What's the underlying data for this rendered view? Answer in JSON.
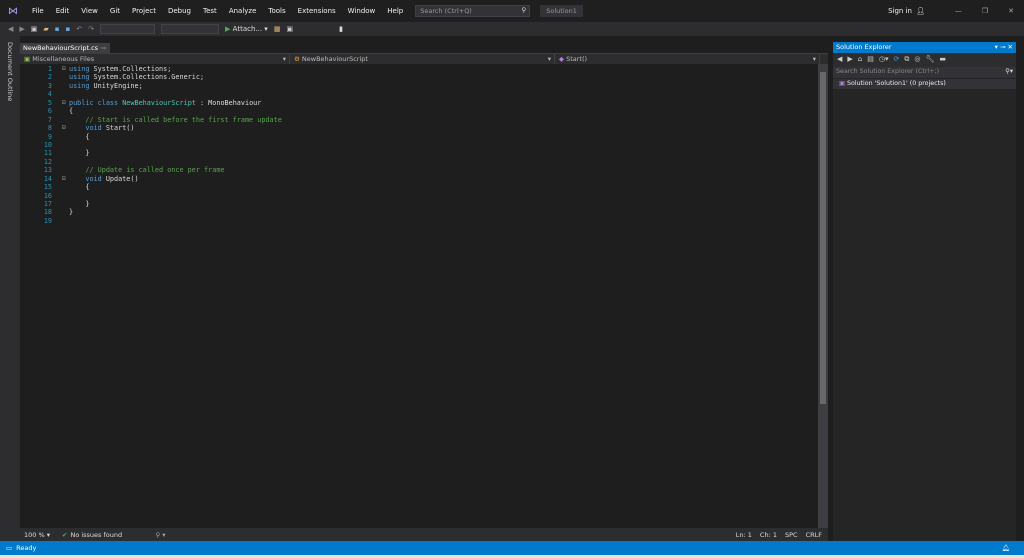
{
  "menu": [
    "File",
    "Edit",
    "View",
    "Git",
    "Project",
    "Debug",
    "Test",
    "Analyze",
    "Tools",
    "Extensions",
    "Window",
    "Help"
  ],
  "search_placeholder": "Search (Ctrl+Q)",
  "solution_name": "Solution1",
  "sign_in": "Sign in",
  "toolbar": {
    "attach": "Attach..."
  },
  "doc_outline": "Document Outline",
  "tab": {
    "label": "NewBehaviourScript.cs"
  },
  "nav": {
    "project": "Miscellaneous Files",
    "type": "NewBehaviourScript",
    "member": "Start()"
  },
  "code": [
    [
      "1",
      "using System.Collections;"
    ],
    [
      "2",
      "using System.Collections.Generic;"
    ],
    [
      "3",
      "using UnityEngine;"
    ],
    [
      "4",
      ""
    ],
    [
      "5",
      "public class NewBehaviourScript : MonoBehaviour"
    ],
    [
      "6",
      "{"
    ],
    [
      "7",
      "    // Start is called before the first frame update"
    ],
    [
      "8",
      "    void Start()"
    ],
    [
      "9",
      "    {"
    ],
    [
      "10",
      ""
    ],
    [
      "11",
      "    }"
    ],
    [
      "12",
      ""
    ],
    [
      "13",
      "    // Update is called once per frame"
    ],
    [
      "14",
      "    void Update()"
    ],
    [
      "15",
      "    {"
    ],
    [
      "16",
      ""
    ],
    [
      "17",
      "    }"
    ],
    [
      "18",
      "}"
    ],
    [
      "19",
      ""
    ]
  ],
  "editor_status": {
    "zoom": "100 %",
    "issues": "No issues found",
    "ln": "Ln: 1",
    "ch": "Ch: 1",
    "spc": "SPC",
    "crlf": "CRLF"
  },
  "solution_explorer": {
    "title": "Solution Explorer",
    "search_placeholder": "Search Solution Explorer (Ctrl+;)",
    "item": "Solution 'Solution1' (0 projects)"
  },
  "status": {
    "text": "Ready"
  },
  "colors": {
    "accent": "#007acc",
    "keyword": "#569cd6",
    "type": "#4ec9b0",
    "comment": "#57a64a"
  }
}
